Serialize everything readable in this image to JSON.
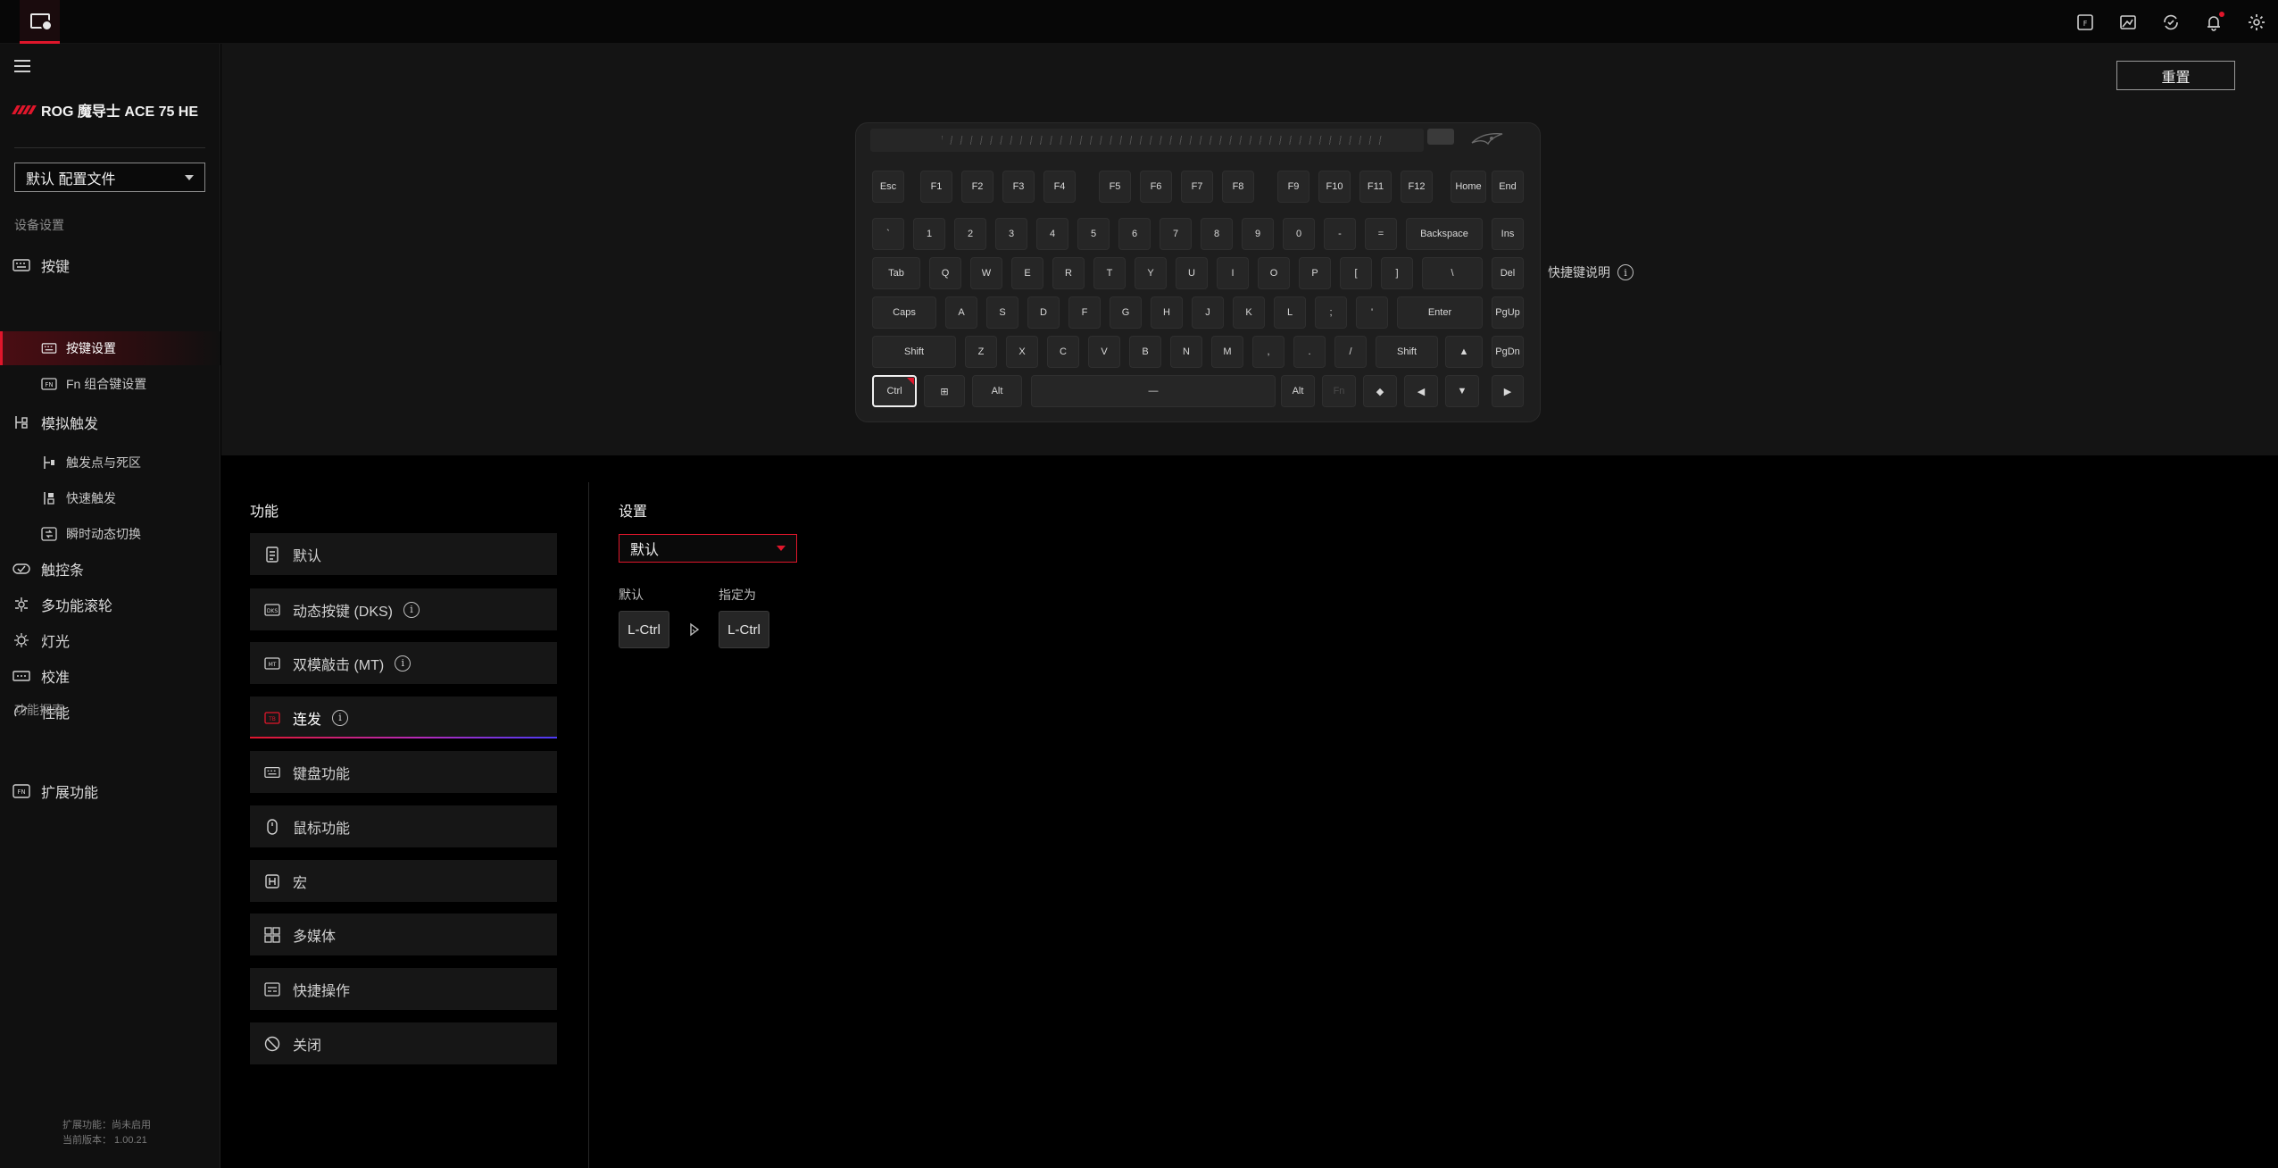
{
  "device": {
    "name": "ROG 魔导士 ACE 75 HE"
  },
  "profile": {
    "selected": "默认 配置文件"
  },
  "sidebar": {
    "section_device": "设备设置",
    "section_explore": "功能探索",
    "items": [
      {
        "label": "按键",
        "icon": "keyboard-icon"
      },
      {
        "label": "按键设置",
        "icon": "keyboard-icon",
        "active": true
      },
      {
        "label": "Fn 组合键设置",
        "icon": "fn-icon"
      },
      {
        "label": "模拟触发",
        "icon": "analog-trigger-icon"
      },
      {
        "label": "触发点与死区",
        "icon": "trigger-point-icon"
      },
      {
        "label": "快速触发",
        "icon": "rapid-trigger-icon"
      },
      {
        "label": "瞬时动态切换",
        "icon": "snap-switch-icon"
      },
      {
        "label": "触控条",
        "icon": "touchbar-icon"
      },
      {
        "label": "多功能滚轮",
        "icon": "scroll-wheel-icon"
      },
      {
        "label": "灯光",
        "icon": "lighting-icon"
      },
      {
        "label": "校准",
        "icon": "calibration-icon"
      },
      {
        "label": "性能",
        "icon": "performance-icon"
      },
      {
        "label": "扩展功能",
        "icon": "extension-icon"
      }
    ],
    "footer_line1": "扩展功能：尚未启用",
    "footer_line2": "当前版本： 1.00.21"
  },
  "header": {
    "reset_label": "重置",
    "icons": [
      "fn-icon",
      "image-icon",
      "sync-icon",
      "bell-icon",
      "gear-icon"
    ],
    "notification": true
  },
  "keyboard": {
    "row_fn": [
      "Esc",
      "F1",
      "F2",
      "F3",
      "F4",
      "F5",
      "F6",
      "F7",
      "F8",
      "F9",
      "F10",
      "F11",
      "F12",
      "Home",
      "End"
    ],
    "row_num": [
      "`",
      "1",
      "2",
      "3",
      "4",
      "5",
      "6",
      "7",
      "8",
      "9",
      "0",
      "-",
      "=",
      "Backspace",
      "Ins"
    ],
    "row_tab": [
      "Tab",
      "Q",
      "W",
      "E",
      "R",
      "T",
      "Y",
      "U",
      "I",
      "O",
      "P",
      "[",
      "]",
      "\\",
      "Del"
    ],
    "row_caps": [
      "Caps",
      "A",
      "S",
      "D",
      "F",
      "G",
      "H",
      "J",
      "K",
      "L",
      ";",
      "'",
      "Enter",
      "PgUp"
    ],
    "row_shift": [
      "Shift",
      "Z",
      "X",
      "C",
      "V",
      "B",
      "N",
      "M",
      ",",
      ".",
      "/",
      "Shift",
      "▲",
      "PgDn"
    ],
    "row_ctrl": [
      "Ctrl",
      "⊞",
      "Alt",
      "—",
      "Alt",
      "Fn",
      "◆",
      "◀",
      "▼",
      "▶"
    ],
    "selected_key": "Ctrl",
    "hint": "快捷键说明"
  },
  "functions": {
    "title": "功能",
    "items": [
      {
        "label": "默认",
        "icon": "default-icon",
        "info": false
      },
      {
        "label": "动态按键 (DKS)",
        "icon": "dks-icon",
        "info": true
      },
      {
        "label": "双模敲击 (MT)",
        "icon": "mt-icon",
        "info": true
      },
      {
        "label": "连发",
        "icon": "turbo-icon",
        "info": true,
        "active": true
      },
      {
        "label": "键盘功能",
        "icon": "keyboard-icon",
        "info": false
      },
      {
        "label": "鼠标功能",
        "icon": "mouse-icon",
        "info": false
      },
      {
        "label": "宏",
        "icon": "macro-icon",
        "info": false
      },
      {
        "label": "多媒体",
        "icon": "multimedia-icon",
        "info": false
      },
      {
        "label": "快捷操作",
        "icon": "shortcut-icon",
        "info": false
      },
      {
        "label": "关闭",
        "icon": "disable-icon",
        "info": false
      }
    ]
  },
  "settings": {
    "title": "设置",
    "selected": "默认",
    "default_label": "默认",
    "assign_label": "指定为",
    "default_key": "L-Ctrl",
    "assigned_key": "L-Ctrl"
  },
  "colors": {
    "accent": "#e0162b",
    "panel": "#161616",
    "background": "#000000"
  }
}
